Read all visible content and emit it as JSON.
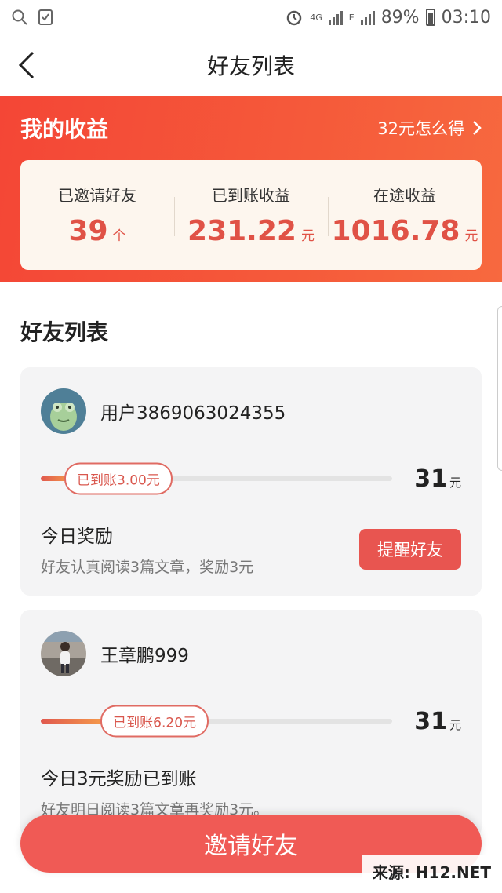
{
  "status_bar": {
    "network": "4G",
    "network_sub": "E",
    "battery": "89%",
    "time": "03:10"
  },
  "nav": {
    "title": "好友列表"
  },
  "earnings": {
    "title": "我的收益",
    "link": "32元怎么得",
    "stats": [
      {
        "label": "已邀请好友",
        "value": "39",
        "unit": "个"
      },
      {
        "label": "已到账收益",
        "value": "231.22",
        "unit": "元"
      },
      {
        "label": "在途收益",
        "value": "1016.78",
        "unit": "元"
      }
    ]
  },
  "friends": {
    "section_title": "好友列表",
    "items": [
      {
        "name": "用户3869063024355",
        "received_label": "已到账3.00元",
        "progress": 0.097,
        "reward": "31",
        "reward_unit": "元",
        "today_title": "今日奖励",
        "today_desc": "好友认真阅读3篇文章，奖励3元",
        "button_label": "提醒好友"
      },
      {
        "name": "王章鹏999",
        "received_label": "已到账6.20元",
        "progress": 0.2,
        "reward": "31",
        "reward_unit": "元",
        "today_title": "今日3元奖励已到账",
        "today_desc": "好友明日阅读3篇文章再奖励3元。"
      }
    ]
  },
  "invite_button": "邀请好友",
  "watermark": "来源:  H12.NET",
  "colors": {
    "brand_red": "#f44636",
    "accent_text": "#e05246",
    "button_red": "#f05a55"
  }
}
